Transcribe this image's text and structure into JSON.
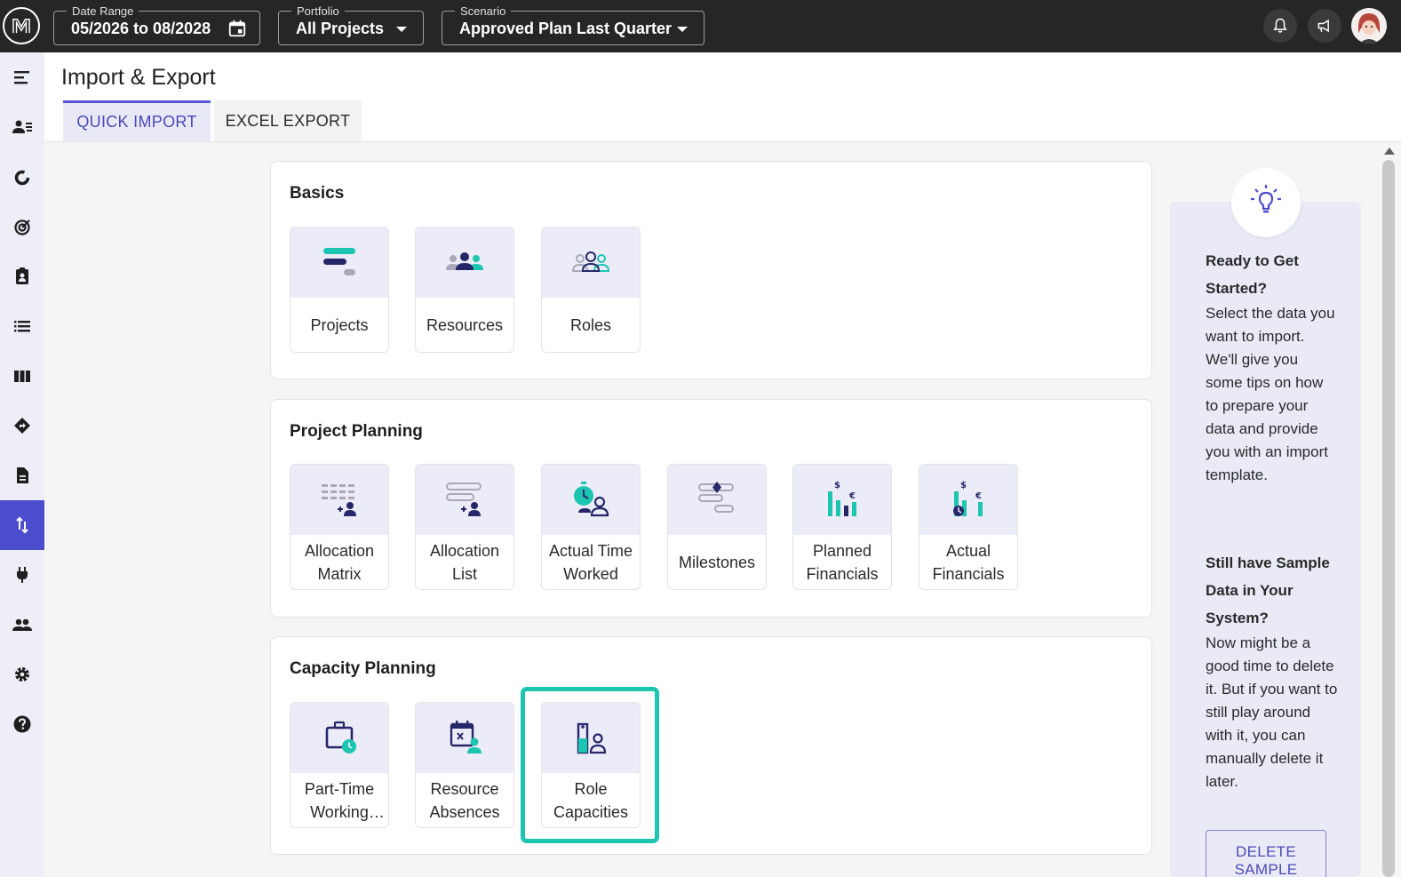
{
  "topbar": {
    "date_range": {
      "label": "Date Range",
      "value": "05/2026 to 08/2028"
    },
    "portfolio": {
      "label": "Portfolio",
      "value": "All Projects"
    },
    "scenario": {
      "label": "Scenario",
      "value": "Approved Plan Last Quarter"
    }
  },
  "page": {
    "title": "Import & Export"
  },
  "tabs": {
    "quick_import": "QUICK IMPORT",
    "excel_export": "EXCEL EXPORT"
  },
  "sections": {
    "basics": {
      "title": "Basics",
      "cards": [
        "Projects",
        "Resources",
        "Roles"
      ]
    },
    "project_planning": {
      "title": "Project Planning",
      "cards": [
        "Allocation Matrix",
        "Allocation List",
        "Actual Time Worked",
        "Milestones",
        "Planned Financials",
        "Actual Financials"
      ]
    },
    "capacity_planning": {
      "title": "Capacity Planning",
      "cards": [
        "Part-Time Working Hours",
        "Resource Absences",
        "Role Capacities"
      ]
    }
  },
  "tips": {
    "heading1": "Ready to Get Started?",
    "text1": "Select the data you want to import. We'll give you some tips on how to prepare your data and provide you with an import template.",
    "heading2": "Still have Sample Data in Your System?",
    "text2": "Now might be a good time to delete it. But if you want to still play around with it, you can manually delete it later.",
    "delete_button": "DELETE SAMPLE"
  },
  "colors": {
    "accent": "#4c4ccf",
    "teal": "#1cc5b0",
    "navy": "#26276b"
  },
  "icons": {
    "sidebar": [
      "menu-icon",
      "people-list-icon",
      "donut-chart-icon",
      "target-icon",
      "assignment-icon",
      "list-icon",
      "columns-icon",
      "roadmap-icon",
      "document-icon",
      "import-export-icon",
      "plug-icon",
      "users-icon",
      "gear-icon",
      "help-icon"
    ]
  }
}
